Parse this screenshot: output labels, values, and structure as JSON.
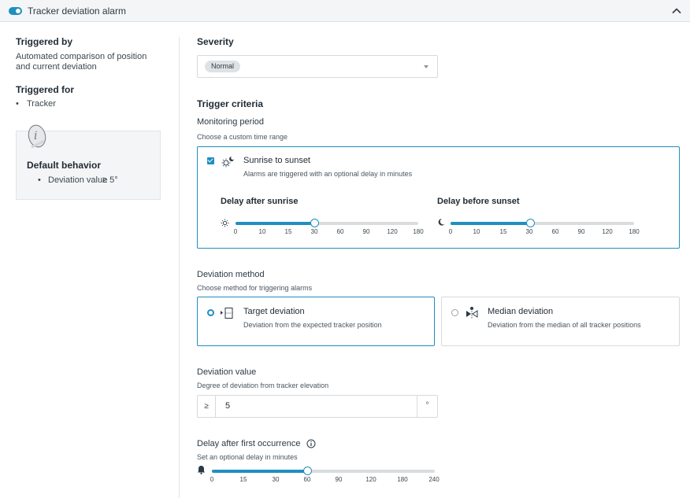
{
  "header": {
    "title": "Tracker deviation alarm",
    "toggle_on": true
  },
  "sidebar": {
    "triggered_by_heading": "Triggered by",
    "triggered_by_line1": "Automated comparison of position",
    "triggered_by_line2": "and current deviation",
    "triggered_for_heading": "Triggered for",
    "triggered_for_item": "Tracker",
    "default_behavior": {
      "heading": "Default behavior",
      "item_label": "Deviation value",
      "item_value": "≥ 5°"
    }
  },
  "severity": {
    "heading": "Severity",
    "selected": "Normal"
  },
  "trigger_criteria": {
    "heading": "Trigger criteria",
    "monitoring_period": {
      "label": "Monitoring period",
      "hint": "Choose a custom time range",
      "option_title": "Sunrise to sunset",
      "option_desc": "Alarms are triggered with an optional delay in minutes",
      "checked": true,
      "delay_after_sunrise": {
        "label": "Delay after sunrise",
        "ticks": [
          "0",
          "10",
          "15",
          "30",
          "60",
          "90",
          "120",
          "180"
        ],
        "value": "30"
      },
      "delay_before_sunset": {
        "label": "Delay before sunset",
        "ticks": [
          "0",
          "10",
          "15",
          "30",
          "60",
          "90",
          "120",
          "180"
        ],
        "value": "30"
      }
    },
    "deviation_method": {
      "label": "Deviation method",
      "hint": "Choose method for triggering alarms",
      "options": [
        {
          "title": "Target deviation",
          "desc": "Deviation from the expected tracker position",
          "selected": true
        },
        {
          "title": "Median deviation",
          "desc": "Deviation from the median of all tracker positions",
          "selected": false
        }
      ]
    },
    "deviation_value": {
      "label": "Deviation value",
      "hint": "Degree of deviation from tracker elevation",
      "prefix": "≥",
      "value": "5",
      "suffix": "°"
    },
    "delay_first_occurrence": {
      "label": "Delay after first occurrence",
      "hint": "Set an optional delay in minutes",
      "ticks": [
        "0",
        "15",
        "30",
        "60",
        "90",
        "120",
        "180",
        "240"
      ],
      "value": "60"
    }
  },
  "colors": {
    "accent": "#1f8fbf",
    "panel_bg": "#f4f5f6",
    "border": "#d6dadd"
  },
  "icons": {
    "toggle": "toggle-switch",
    "collapse": "chevron-up-icon",
    "info": "info-circle-icon",
    "sun": "sun-icon",
    "moon": "moon-icon",
    "sunrise_sunset": "sun-moon-icon",
    "target": "target-deviation-icon",
    "median": "median-deviation-icon",
    "bell": "bell-icon"
  }
}
